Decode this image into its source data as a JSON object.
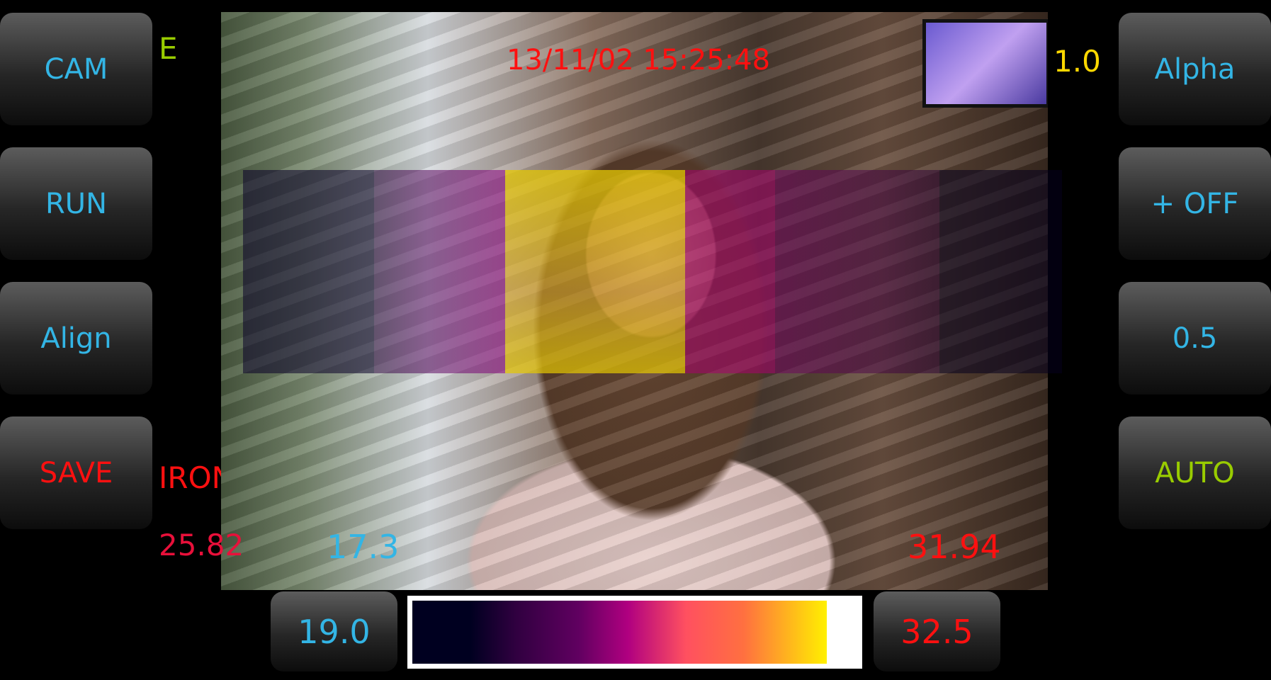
{
  "left_buttons": [
    {
      "label": "CAM",
      "color": "#33b5e5"
    },
    {
      "label": "RUN",
      "color": "#33b5e5"
    },
    {
      "label": "Align",
      "color": "#33b5e5"
    },
    {
      "label": "SAVE",
      "color": "#ff1010"
    }
  ],
  "right_buttons": [
    {
      "label": "Alpha",
      "color": "#33b5e5"
    },
    {
      "label": "+ OFF",
      "color": "#33b5e5"
    },
    {
      "label": "0.5",
      "color": "#33b5e5"
    },
    {
      "label": "AUTO",
      "color": "#99cc00"
    }
  ],
  "overlay_text": {
    "mode": "E",
    "timestamp": "13/11/02 15:25:48",
    "alpha_value": "1.0",
    "palette": "IRON",
    "center_temp": "25.82",
    "min_temp": "17.3",
    "max_temp": "31.94"
  },
  "scale": {
    "min_button": "19.0",
    "max_button": "32.5",
    "palette_colors": [
      "#000020",
      "#600060",
      "#b00080",
      "#ff5060",
      "#ffb020",
      "#fff000"
    ]
  }
}
